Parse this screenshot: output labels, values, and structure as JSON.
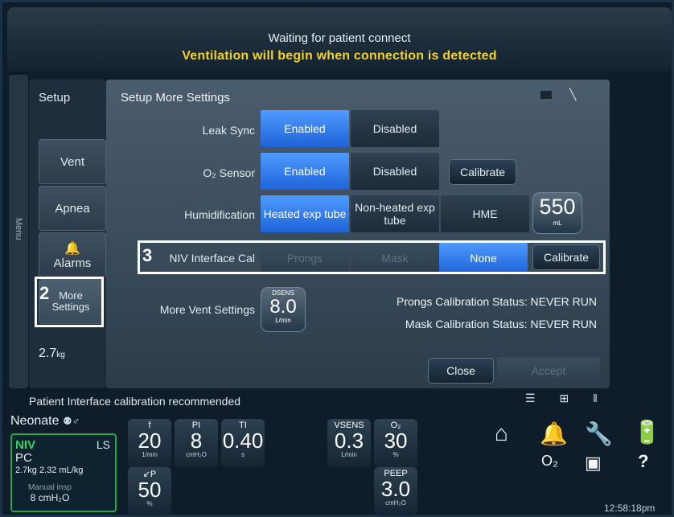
{
  "header": {
    "line1": "Waiting for patient connect",
    "line2": "Ventilation will begin when connection is detected"
  },
  "menu_strip": {
    "label": "Menu"
  },
  "nav": {
    "title": "Setup",
    "items": [
      "Vent",
      "Apnea",
      "Alarms",
      "More Settings"
    ],
    "weight": "2.7",
    "weight_unit": "kg"
  },
  "main": {
    "title": "Setup More Settings",
    "leak_sync": {
      "label": "Leak Sync",
      "options": [
        "Enabled",
        "Disabled"
      ],
      "selected": "Enabled"
    },
    "o2_sensor": {
      "label": "O₂ Sensor",
      "options": [
        "Enabled",
        "Disabled"
      ],
      "selected": "Enabled",
      "calibrate": "Calibrate"
    },
    "humidification": {
      "label": "Humidification",
      "options": [
        "Heated exp tube",
        "Non-heated exp tube",
        "HME"
      ],
      "selected": "Heated exp tube",
      "volume_value": "550",
      "volume_unit": "mL"
    },
    "niv_interface": {
      "label": "NIV Interface Cal",
      "options": [
        "Prongs",
        "Mask",
        "None"
      ],
      "selected": "None",
      "calibrate": "Calibrate"
    },
    "more_vent": {
      "label": "More Vent Settings",
      "knob_symbol": "DSENS",
      "knob_value": "8.0",
      "knob_unit": "L/min"
    },
    "prongs_status": "Prongs Calibration Status: NEVER RUN",
    "mask_status": "Mask Calibration Status: NEVER RUN",
    "close": "Close",
    "accept": "Accept"
  },
  "annotations": {
    "a2": "2",
    "a3": "3"
  },
  "bottom": {
    "message": "Patient Interface calibration recommended"
  },
  "patient": {
    "category": "Neonate",
    "mode": "NIV",
    "ls": "LS",
    "type": "PC",
    "weight_line": "2.7kg  2.32 mL/kg",
    "manual": "Manual insp",
    "manual_value": "8 cmH₂O"
  },
  "params": [
    {
      "sym": "f",
      "val": "20",
      "unit": "1/min"
    },
    {
      "sym": "PI",
      "val": "8",
      "unit": "cmH₂O"
    },
    {
      "sym": "TI",
      "val": "0.40",
      "unit": "s"
    },
    {
      "sym": "VSENS",
      "val": "0.3",
      "unit": "L/min"
    },
    {
      "sym": "O₂",
      "val": "30",
      "unit": "%"
    },
    {
      "sym": "↙P",
      "val": "50",
      "unit": "%"
    },
    {
      "sym": "PEEP",
      "val": "3.0",
      "unit": "cmH₂O"
    }
  ],
  "icons": {
    "o2_label": "O₂",
    "time": "12:58:18pm"
  }
}
